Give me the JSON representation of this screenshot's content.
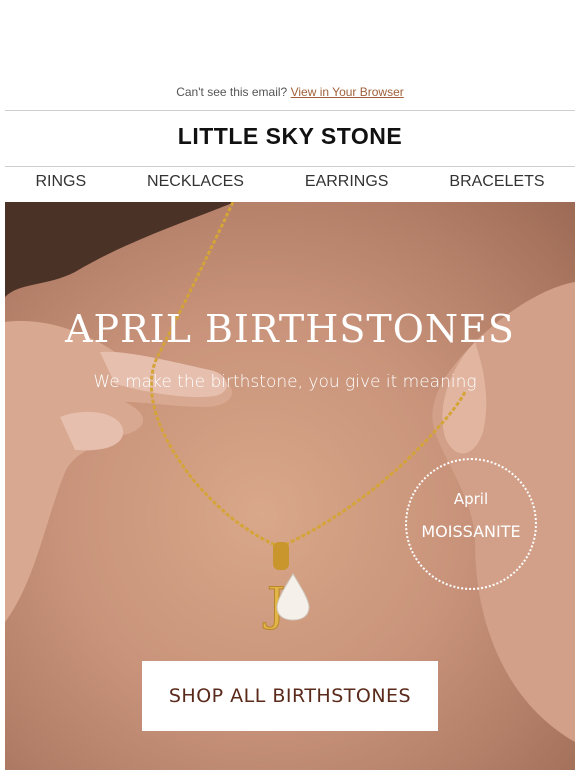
{
  "preheader": {
    "text": "Can't see this email?",
    "link": "View in Your Browser"
  },
  "brand": {
    "name": "LITTLE SKY STONE"
  },
  "nav": {
    "items": [
      "RINGS",
      "NECKLACES",
      "EARRINGS",
      "BRACELETS"
    ]
  },
  "hero": {
    "title": "APRIL BIRTHSTONES",
    "subtitle": "We make the birthstone, you give it meaning",
    "badge_month": "April",
    "badge_stone": "MOISSANITE",
    "pendant_letter": "J",
    "cta": "SHOP ALL BIRTHSTONES"
  },
  "colors": {
    "accent_link": "#a0603a",
    "cta_text": "#5a2a1a",
    "skin": "#c8937a",
    "gold": "#d4a437"
  }
}
